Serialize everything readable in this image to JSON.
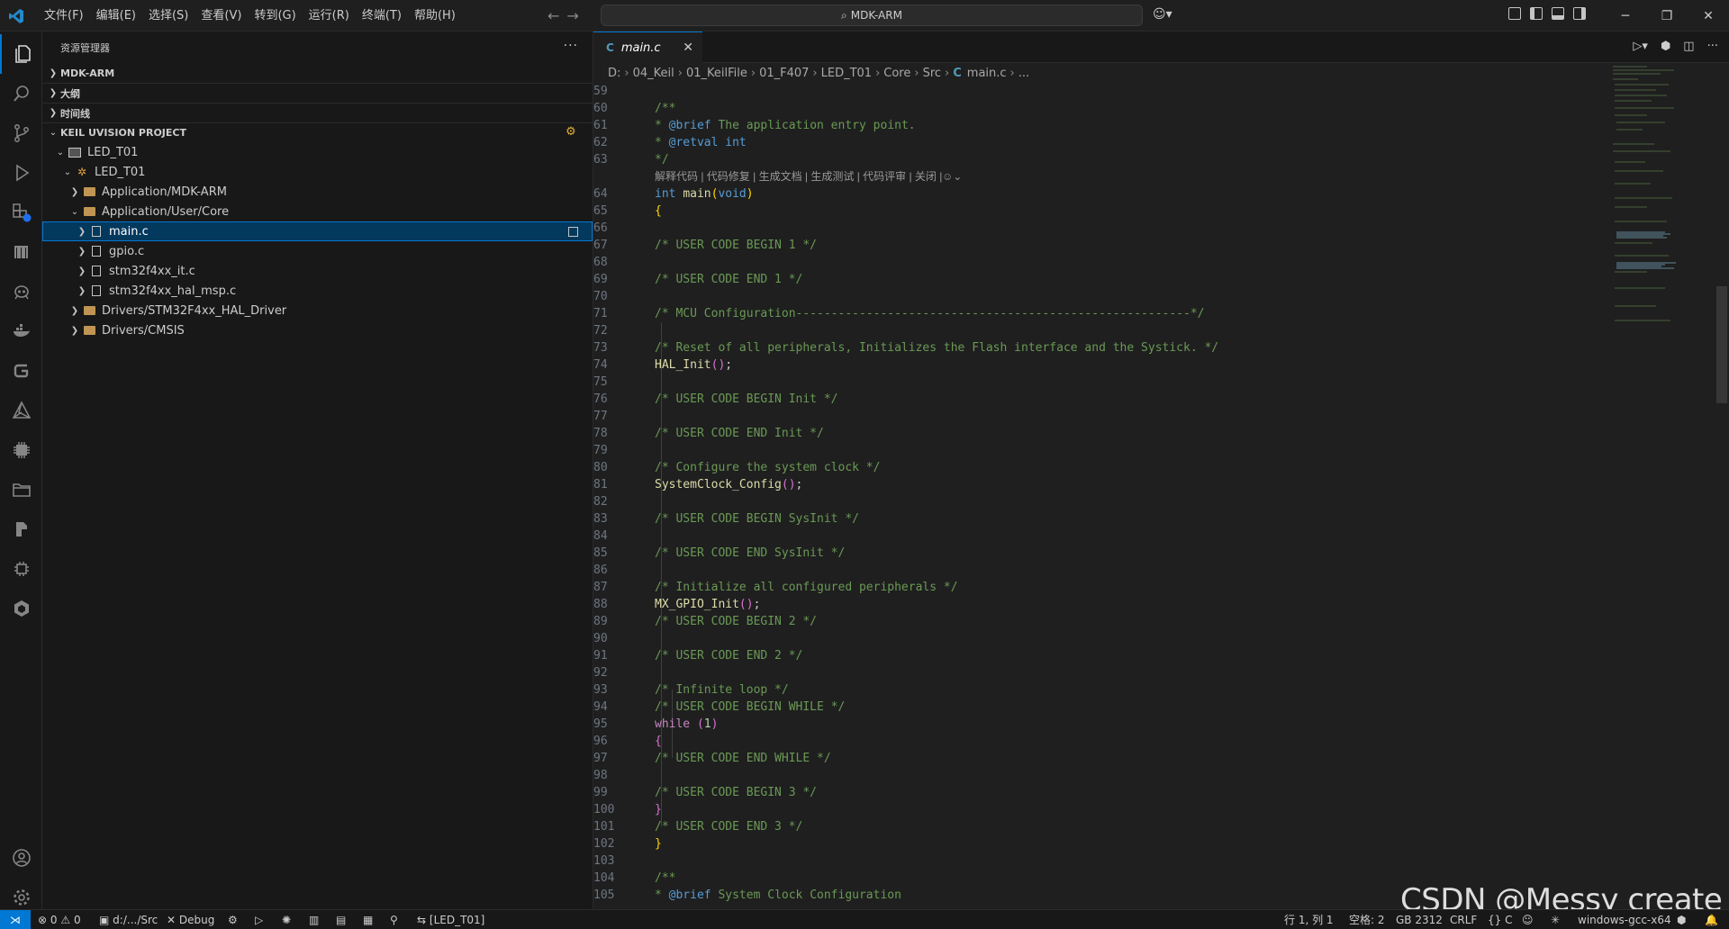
{
  "menu": [
    "文件(F)",
    "编辑(E)",
    "选择(S)",
    "查看(V)",
    "转到(G)",
    "运行(R)",
    "终端(T)",
    "帮助(H)"
  ],
  "command_center": "MDK-ARM",
  "sidebar": {
    "title": "资源管理器",
    "sections": {
      "workspace": "MDK-ARM",
      "outline": "大纲",
      "timeline": "时间线",
      "keil": "KEIL UVISION PROJECT"
    },
    "tree": [
      {
        "label": "LED_T01"
      },
      {
        "label": "LED_T01"
      },
      {
        "label": "Application/MDK-ARM"
      },
      {
        "label": "Application/User/Core"
      },
      {
        "label": "main.c"
      },
      {
        "label": "gpio.c"
      },
      {
        "label": "stm32f4xx_it.c"
      },
      {
        "label": "stm32f4xx_hal_msp.c"
      },
      {
        "label": "Drivers/STM32F4xx_HAL_Driver"
      },
      {
        "label": "Drivers/CMSIS"
      }
    ]
  },
  "editor": {
    "tab": "main.c",
    "breadcrumb": [
      "D:",
      "04_Keil",
      "01_KeilFile",
      "01_F407",
      "LED_T01",
      "Core",
      "Src",
      "main.c",
      "..."
    ],
    "codelens": "解释代码 | 代码修复 | 生成文档 | 生成测试 | 代码评审 | 关闭 |",
    "line_numbers": [
      "59",
      "60",
      "61",
      "62",
      "63",
      "64",
      "65",
      "66",
      "67",
      "68",
      "69",
      "70",
      "71",
      "72",
      "73",
      "74",
      "75",
      "76",
      "77",
      "78",
      "79",
      "80",
      "81",
      "82",
      "83",
      "84",
      "85",
      "86",
      "87",
      "88",
      "89",
      "90",
      "91",
      "92",
      "93",
      "94",
      "95",
      "96",
      "97",
      "98",
      "99",
      "100",
      "101",
      "102",
      "103",
      "104",
      "105"
    ]
  },
  "watermark": "CSDN @Messy create",
  "status": {
    "problems": "0",
    "warnings": "0",
    "folder": "d:/.../Src",
    "debug": "Debug",
    "target": "[LED_T01]",
    "position": "行 1, 列 1",
    "spaces": "空格: 2",
    "encoding": "GB 2312",
    "eol": "CRLF",
    "language": "C",
    "compiler": "windows-gcc-x64"
  },
  "colors": {
    "accent": "#0078d4",
    "comment": "#6a9955",
    "keyword": "#569cd6",
    "function": "#dcdcaa",
    "control": "#c586c0"
  }
}
